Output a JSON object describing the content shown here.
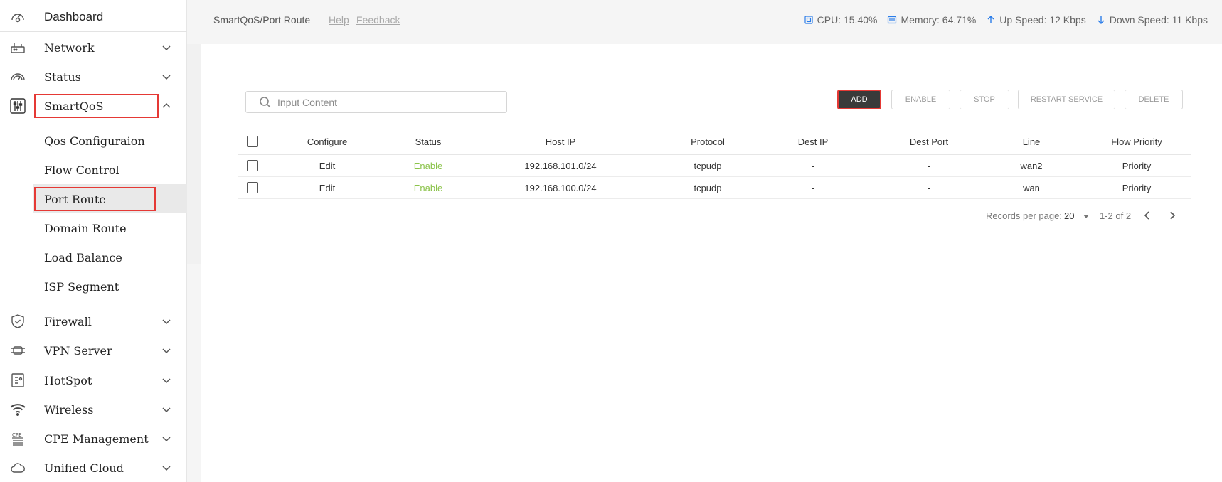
{
  "sidebar": {
    "dashboard": "Dashboard",
    "network": "Network",
    "status": "Status",
    "smartqos": "SmartQoS",
    "submenu": [
      "Qos Configuraion",
      "Flow Control",
      "Port Route",
      "Domain Route",
      "Load Balance",
      "ISP Segment"
    ],
    "firewall": "Firewall",
    "vpn_server": "VPN Server",
    "hotspot": "HotSpot",
    "wireless": "Wireless",
    "cpe_management": "CPE Management",
    "unified_cloud": "Unified Cloud",
    "cpe_icon_text": "CPE"
  },
  "header": {
    "breadcrumb": "SmartQoS/Port Route",
    "help": "Help",
    "feedback": "Feedback",
    "cpu": "CPU: 15.40%",
    "memory": "Memory: 64.71%",
    "up_speed": "Up Speed: 12 Kbps",
    "down_speed": "Down Speed: 11 Kbps"
  },
  "toolbar": {
    "search_placeholder": "Input Content",
    "add": "ADD",
    "enable": "ENABLE",
    "stop": "STOP",
    "restart": "RESTART SERVICE",
    "delete": "DELETE"
  },
  "table": {
    "headers": [
      "Configure",
      "Status",
      "Host IP",
      "Protocol",
      "Dest IP",
      "Dest Port",
      "Line",
      "Flow Priority"
    ],
    "rows": [
      [
        "Edit",
        "Enable",
        "192.168.101.0/24",
        "tcpudp",
        "-",
        "-",
        "wan2",
        "Priority"
      ],
      [
        "Edit",
        "Enable",
        "192.168.100.0/24",
        "tcpudp",
        "-",
        "-",
        "wan",
        "Priority"
      ]
    ]
  },
  "pagination": {
    "label": "Records per page:",
    "per_page": "20",
    "range": "1-2 of 2"
  },
  "colors": {
    "accent_highlight": "#e53935",
    "status_enable": "#8bc34a",
    "primary_button": "#3a3a3a"
  }
}
